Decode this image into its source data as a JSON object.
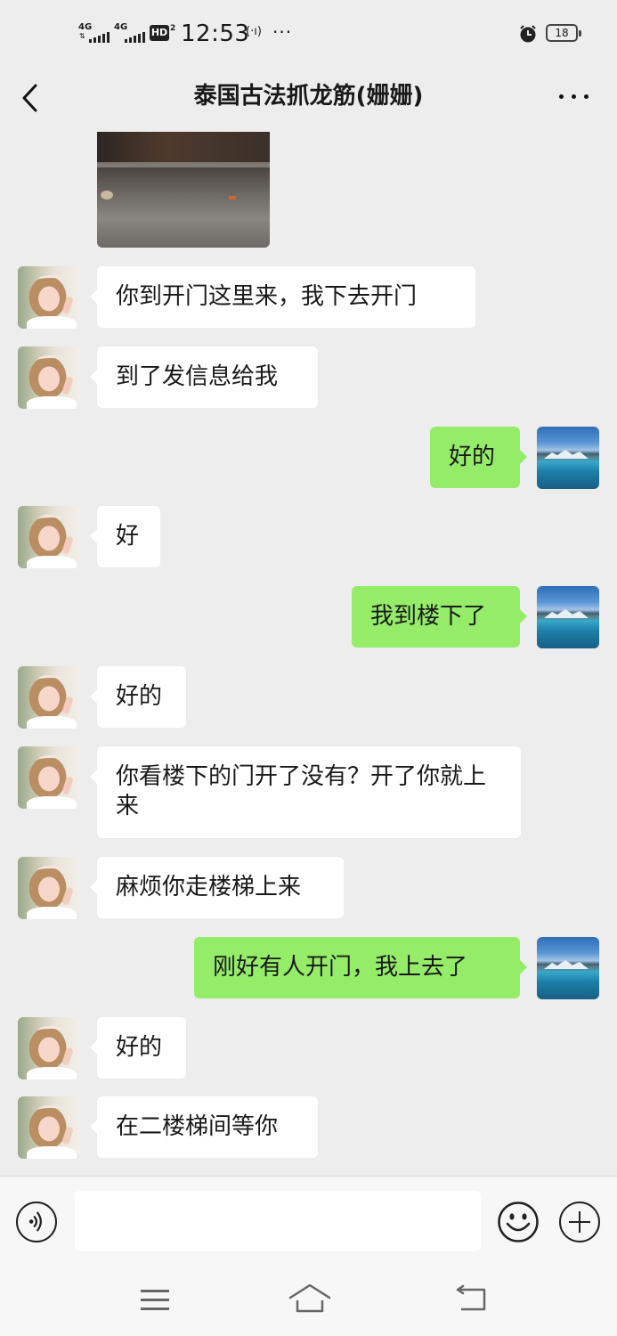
{
  "status_bar": {
    "sim1_network": "4G",
    "sim2_network": "4G",
    "hd_label": "HD",
    "hd_sub": "2",
    "time": "12:53",
    "more": "···",
    "battery_level": "18",
    "icons": [
      "signal-bars-icon",
      "wifi-hotspot-icon",
      "alarm-clock-icon",
      "battery-icon"
    ]
  },
  "header": {
    "title": "泰国古法抓龙筋(姗姗)",
    "back_icon": "chevron-left-icon",
    "more_icon": "more-dots-icon"
  },
  "messages": [
    {
      "side": "in",
      "type": "image"
    },
    {
      "side": "in",
      "type": "text",
      "text": "你到开门这里来，我下去开门"
    },
    {
      "side": "in",
      "type": "text",
      "text": "到了发信息给我"
    },
    {
      "side": "out",
      "type": "text",
      "text": "好的"
    },
    {
      "side": "in",
      "type": "text",
      "text": "好"
    },
    {
      "side": "out",
      "type": "text",
      "text": "我到楼下了"
    },
    {
      "side": "in",
      "type": "text",
      "text": "好的"
    },
    {
      "side": "in",
      "type": "text",
      "text": "你看楼下的门开了没有？开了你就上来"
    },
    {
      "side": "in",
      "type": "text",
      "text": "麻烦你走楼梯上来"
    },
    {
      "side": "out",
      "type": "text",
      "text": "刚好有人开门，我上去了"
    },
    {
      "side": "in",
      "type": "text",
      "text": "好的"
    },
    {
      "side": "in",
      "type": "text",
      "text": "在二楼梯间等你"
    }
  ],
  "input_bar": {
    "text_value": "",
    "icons": [
      "voice-input-icon",
      "emoji-icon",
      "plus-icon"
    ]
  },
  "nav_bar": {
    "icons": [
      "menu-icon",
      "home-icon",
      "back-icon"
    ]
  },
  "colors": {
    "background": "#ededed",
    "incoming_bubble": "#ffffff",
    "outgoing_bubble": "#95ec69",
    "text": "#191919"
  }
}
